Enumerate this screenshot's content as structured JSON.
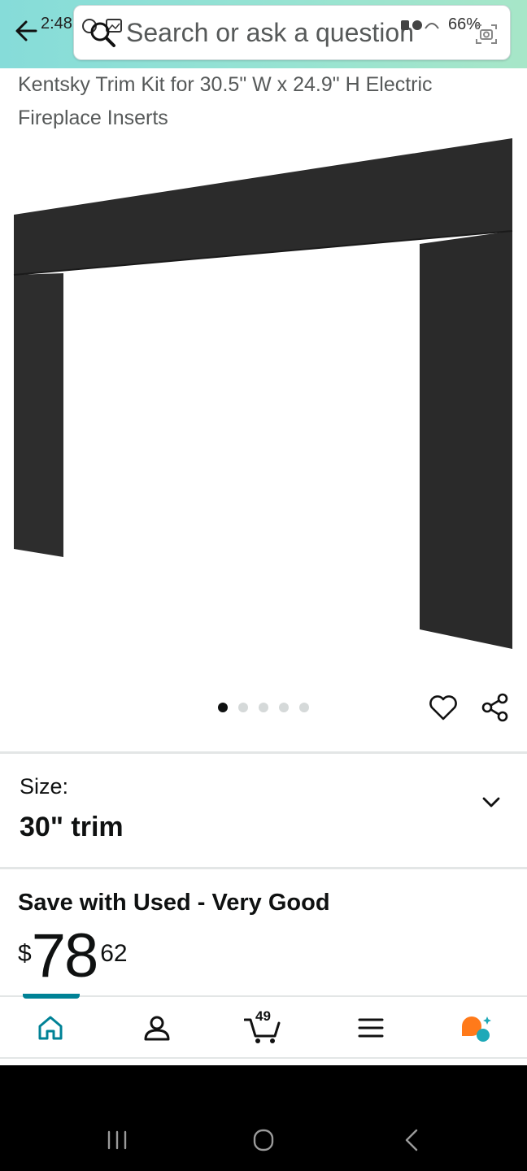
{
  "status_bar": {
    "time": "2:48",
    "battery": "66%"
  },
  "search": {
    "placeholder": "Search or ask a question"
  },
  "product": {
    "title": "Kentsky Trim Kit for 30.5\" W x 24.9\" H Electric Fireplace Inserts",
    "image_count": 5,
    "active_image": 1
  },
  "size": {
    "label": "Size:",
    "value": "30\" trim"
  },
  "offer": {
    "title": "Save with Used - Very Good",
    "currency": "$",
    "whole": "78",
    "fraction": "62"
  },
  "nav": {
    "cart_count": "49",
    "items": [
      "home-icon",
      "account-icon",
      "cart-icon",
      "menu-icon",
      "rufus-icon"
    ]
  },
  "colors": {
    "header_start": "#86dcd9",
    "header_end": "#a7e6c8",
    "accent": "#008296",
    "rufus_orange": "#ff7a1a",
    "rufus_teal": "#1ea9b8"
  }
}
